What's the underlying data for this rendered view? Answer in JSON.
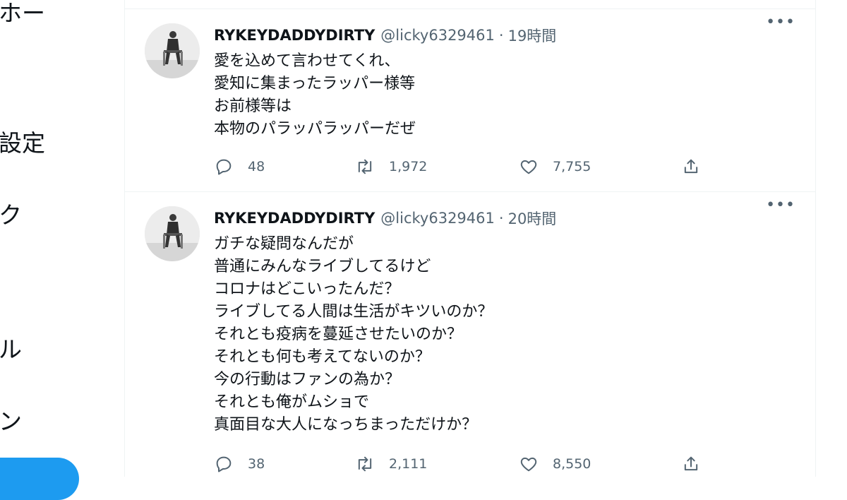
{
  "nav_fragments": [
    "ホー",
    "設定",
    "ク",
    "ル",
    "ン"
  ],
  "tweets": [
    {
      "name": "RYKEYDADDYDIRTY",
      "handle": "@licky6329461",
      "separator": "·",
      "time": "19時間",
      "lines": [
        "愛を込めて言わせてくれ、",
        "愛知に集まったラッパー様等",
        "お前様等は",
        "本物のパラッパラッパーだぜ"
      ],
      "replies": "48",
      "retweets": "1,972",
      "likes": "7,755"
    },
    {
      "name": "RYKEYDADDYDIRTY",
      "handle": "@licky6329461",
      "separator": "·",
      "time": "20時間",
      "lines": [
        "ガチな疑問なんだが",
        "普通にみんなライブしてるけど",
        "コロナはどこいったんだ？",
        "ライブしてる人間は生活がキツいのか？",
        "それとも疫病を蔓延させたいのか？",
        "それとも何も考えてないのか？",
        "今の行動はファンの為か？",
        "それとも俺がムショで",
        "真面目な大人になっちまっただけか？"
      ],
      "replies": "38",
      "retweets": "2,111",
      "likes": "8,550"
    }
  ],
  "icons": {
    "more": "more-horizontal-icon",
    "reply": "reply-icon",
    "retweet": "retweet-icon",
    "like": "heart-icon",
    "share": "share-icon"
  },
  "colors": {
    "secondary_text": "#536471",
    "accent": "#1d9bf0",
    "divider": "#eff3f4"
  }
}
